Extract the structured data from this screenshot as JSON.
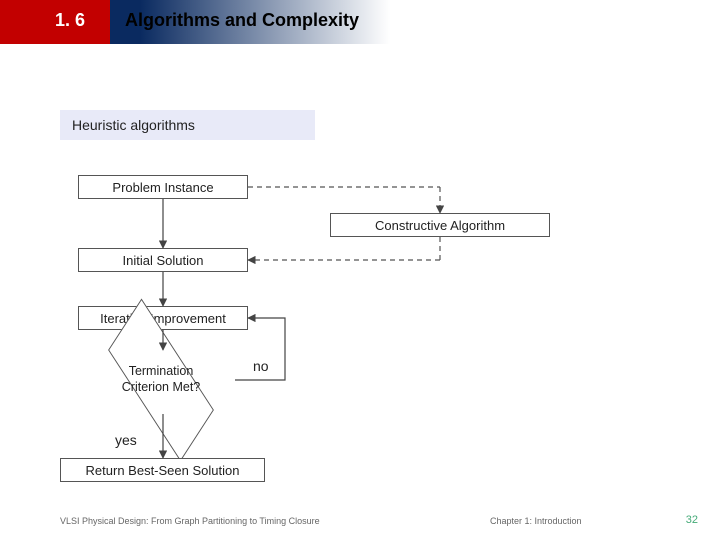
{
  "header": {
    "section_number": "1. 6",
    "title": "Algorithms and Complexity"
  },
  "subheading": "Heuristic algorithms",
  "flow": {
    "problem_instance": "Problem Instance",
    "constructive": "Constructive Algorithm",
    "initial_solution": "Initial Solution",
    "iterative_improvement": "Iterative Improvement",
    "termination": "Termination\nCriterion Met?",
    "no_label": "no",
    "yes_label": "yes",
    "return_best": "Return Best-Seen Solution"
  },
  "footer": {
    "left": "VLSI Physical Design: From Graph Partitioning to Timing Closure",
    "chapter": "Chapter 1: Introduction",
    "page": "32"
  }
}
